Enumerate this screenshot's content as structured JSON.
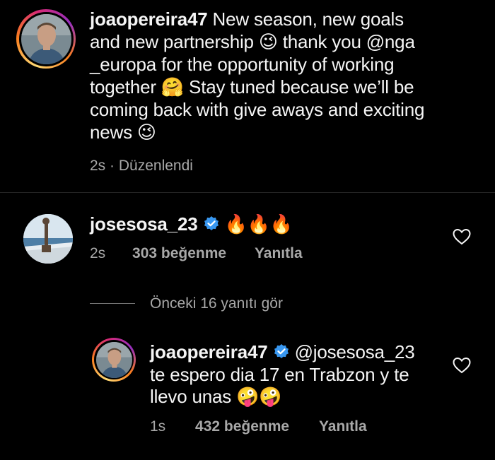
{
  "post": {
    "username": "joaopereira47",
    "caption_1": " New season, new goals",
    "caption_2": "and new partnership ",
    "emoji_wink": "😉",
    "caption_3": " thank you @nga",
    "caption_4": "_europa for the opportunity of working",
    "caption_5": "together ",
    "emoji_hug": "🤗",
    "caption_6": "  Stay tuned because we’ll be",
    "caption_7": "coming back with give aways and exciting",
    "caption_8": "news ",
    "time": "2s",
    "separator": " · ",
    "edited": "Düzenlendi"
  },
  "comment": {
    "username": "josesosa_23",
    "fire": "🔥🔥🔥",
    "time": "2s",
    "likes": "303 beğenme",
    "reply": "Yanıtla"
  },
  "view_replies": "Önceki 16 yanıtı gör",
  "reply": {
    "username": "joaopereira47",
    "mention": "@josesosa_23",
    "line_2": "te espero dia 17 en Trabzon y te",
    "line_3": "llevo unas ",
    "emoji_crazy": "🤪🤪",
    "time": "1s",
    "likes": "432 beğenme",
    "reply": "Yanıtla"
  },
  "colors": {
    "background": "#000000",
    "text": "#f5f5f5",
    "meta": "#a8a8a8",
    "verified": "#3897f0"
  }
}
